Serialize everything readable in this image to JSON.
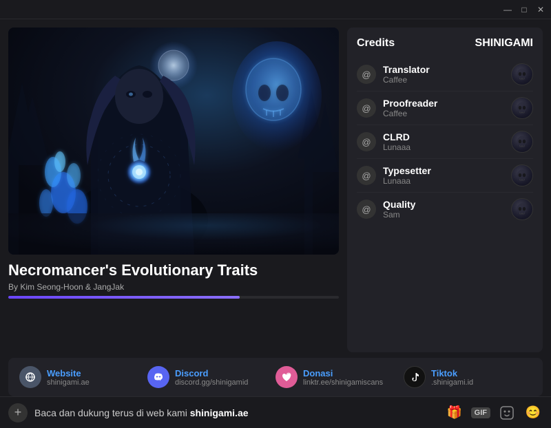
{
  "titlebar": {
    "minimize_label": "—",
    "maximize_label": "□",
    "close_label": "✕"
  },
  "manga": {
    "title": "Necromancer's Evolutionary Traits",
    "author": "By Kim Seong-Hoon & JangJak",
    "progress_percent": 70
  },
  "credits": {
    "label": "Credits",
    "brand": "SHINIGAMI",
    "roles": [
      {
        "role": "Translator",
        "name": "Caffee"
      },
      {
        "role": "Proofreader",
        "name": "Caffee"
      },
      {
        "role": "CLRD",
        "name": "Lunaaa"
      },
      {
        "role": "Typesetter",
        "name": "Lunaaa"
      },
      {
        "role": "Quality",
        "name": "Sam"
      }
    ]
  },
  "social": [
    {
      "id": "website",
      "label": "Website",
      "url": "shinigami.ae",
      "icon": "🔗",
      "color": "website"
    },
    {
      "id": "discord",
      "label": "Discord",
      "url": "discord.gg/shinigamid",
      "icon": "💬",
      "color": "discord"
    },
    {
      "id": "donasi",
      "label": "Donasi",
      "url": "linktr.ee/shinigamiscans",
      "icon": "💝",
      "color": "donasi"
    },
    {
      "id": "tiktok",
      "label": "Tiktok",
      "url": ".shinigami.id",
      "icon": "♪",
      "color": "tiktok"
    }
  ],
  "bottombar": {
    "message_prefix": "Baca dan dukung terus di web kami ",
    "message_highlight": "shinigami.ae",
    "add_icon": "+",
    "gift_icon": "🎁",
    "gif_label": "GIF",
    "sticker_icon": "🗒",
    "emoji_icon": "😊"
  }
}
